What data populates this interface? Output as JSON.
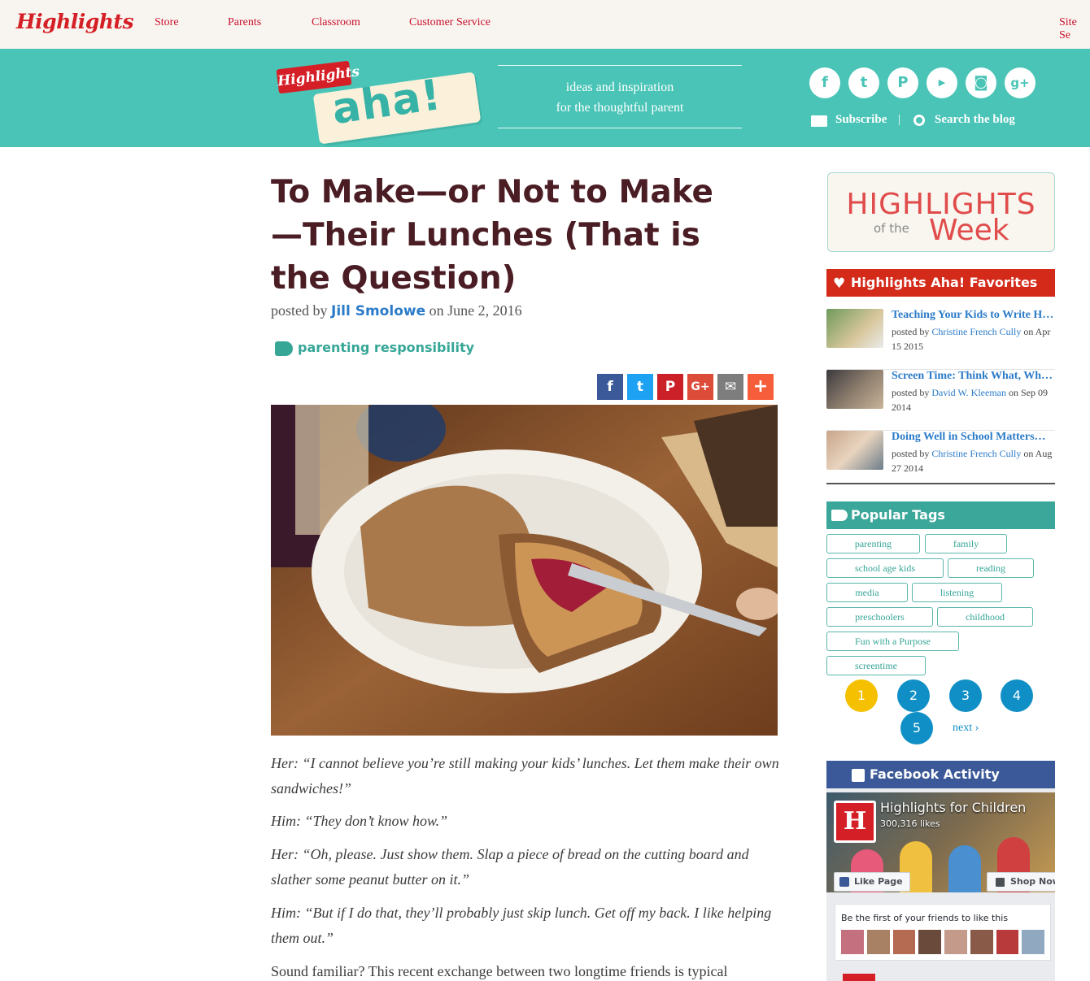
{
  "topnav": {
    "logo": "Highlights",
    "links": [
      "Store",
      "Parents",
      "Classroom",
      "Customer Service",
      "Site Se"
    ]
  },
  "banner": {
    "brand_small": "Highlights",
    "brand_big": "aha!",
    "tagline_1": "ideas and inspiration",
    "tagline_2": "for the thoughtful parent",
    "social_icons": [
      "facebook-icon",
      "twitter-icon",
      "pinterest-icon",
      "youtube-icon",
      "instagram-icon",
      "google-plus-icon"
    ],
    "subscribe": "Subscribe",
    "separator": "|",
    "search": "Search the blog"
  },
  "article": {
    "title": "To Make—or Not to Make—Their Lunches (That is the Question)",
    "byline_prefix": "posted by",
    "author": "Jill Smolowe",
    "byline_date": "on June 2, 2016",
    "tags": "parenting responsibility",
    "share_icons": [
      "facebook-icon",
      "twitter-icon",
      "pinterest-icon",
      "google-plus-icon",
      "email-icon",
      "plus-icon"
    ],
    "paragraphs": [
      "Her: “I cannot believe you’re still making your kids’ lunches. Let them make their own sandwiches!”",
      "Him: “They don’t know how.”",
      "Her: “Oh, please. Just show them. Slap a piece of bread on the cutting board and slather some peanut butter on it.”",
      "Him: “But if I do that, they’ll probably just skip lunch. Get off my back. I like helping them out.”",
      "Sound familiar? This recent exchange between two longtime friends is typical"
    ]
  },
  "sidebar": {
    "hotw": {
      "line1": "HIGHLIGHTS",
      "ofthe": "of the",
      "week": "Week"
    },
    "favorites_title": "Highlights Aha! Favorites",
    "favorites": [
      {
        "title": "Teaching Your Kids to Write H…",
        "prefix": "posted by",
        "author": "Christine French Cully",
        "date": "on Apr 15 2015"
      },
      {
        "title": "Screen Time: Think What, Wh…",
        "prefix": "posted by",
        "author": "David W. Kleeman",
        "date": "on Sep 09 2014"
      },
      {
        "title": "Doing Well in School Matters…",
        "prefix": "posted by",
        "author": "Christine French Cully",
        "date": "on Aug 27 2014"
      }
    ],
    "popular_tags_title": "Popular Tags",
    "tags": [
      "parenting",
      "family",
      "school age kids",
      "reading",
      "media",
      "listening",
      "preschoolers",
      "childhood",
      "Fun with a Purpose",
      "screentime"
    ],
    "pages": [
      "1",
      "2",
      "3",
      "4",
      "5"
    ],
    "next": "next ›",
    "facebook_title": "Facebook Activity",
    "fb_page_name": "Highlights for Children",
    "fb_likes": "300,316 likes",
    "fb_like_button": "Like Page",
    "fb_shop_button": "Shop Now",
    "fb_friends_text": "Be the first of your friends to like this"
  },
  "colors": {
    "teal": "#49c4b7",
    "brand_red": "#d51f26",
    "title_maroon": "#4a1c23",
    "link_blue": "#2b7bc8",
    "fav_header_red": "#d42a1a",
    "tags_header_teal": "#3ba79a",
    "page_active_yellow": "#f5c000",
    "page_blue": "#0f8fc5",
    "facebook_blue": "#3b5998"
  }
}
